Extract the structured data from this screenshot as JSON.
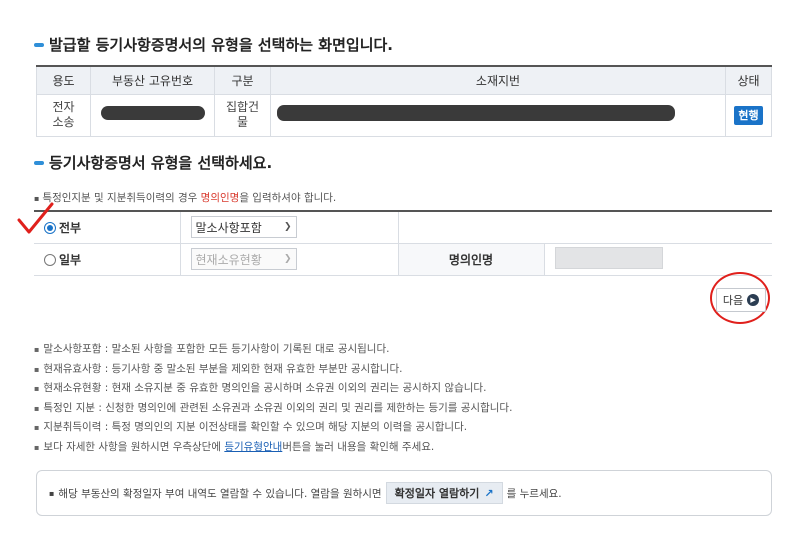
{
  "section1": {
    "title": "발급할 등기사항증명서의 유형을 선택하는 화면입니다.",
    "table": {
      "headers": [
        "용도",
        "부동산 고유번호",
        "구분",
        "소재지번",
        "상태"
      ],
      "row": {
        "usage": "전자\n소송",
        "type": "집합건\n물",
        "status": "현행"
      }
    }
  },
  "section2": {
    "title": "등기사항증명서 유형을 선택하세요.",
    "note_prefix": "특정인지분 및 지분취득이력의 경우 ",
    "note_highlight": "명의인명",
    "note_suffix": "을 입력하셔야 합니다.",
    "options": {
      "all_label": "전부",
      "all_select": "말소사항포함",
      "part_label": "일부",
      "part_select": "현재소유현황",
      "owner_name_label": "명의인명"
    },
    "next_button": "다음"
  },
  "bullets": [
    "말소사항포함 : 말소된 사항을 포함한 모든 등기사항이 기록된 대로 공시됩니다.",
    "현재유효사항 : 등기사항 중 말소된 부분을 제외한 현재 유효한 부분만 공시합니다.",
    "현재소유현황 : 현재 소유지분 중 유효한 명의인을 공시하며 소유권 이외의 권리는 공시하지 않습니다.",
    "특정인 지분 : 신청한 명의인에 관련된 소유권과 소유권 이외의 권리 및 권리를 제한하는 등기를 공시합니다.",
    "지분취득이력 : 특정 명의인의 지분 이전상태를 확인할 수 있으며 해당 지분의 이력을 공시합니다."
  ],
  "bullet_last": {
    "prefix": "보다 자세한 사항을 원하시면 우측상단에 ",
    "link": "등기유형안내",
    "suffix": "버튼을 눌러 내용을 확인해 주세요."
  },
  "infobox": {
    "prefix": "해당 부동산의 확정일자 부여 내역도 열람할 수 있습니다. 열람을 원하시면 ",
    "button": "확정일자 열람하기",
    "suffix": "를 누르세요."
  },
  "colors": {
    "accent": "#1a73c8",
    "annotation": "#e0201c",
    "highlight": "#d93a2e"
  },
  "icons": [
    "next-arrow-icon",
    "external-link-icon",
    "radio-icon"
  ]
}
